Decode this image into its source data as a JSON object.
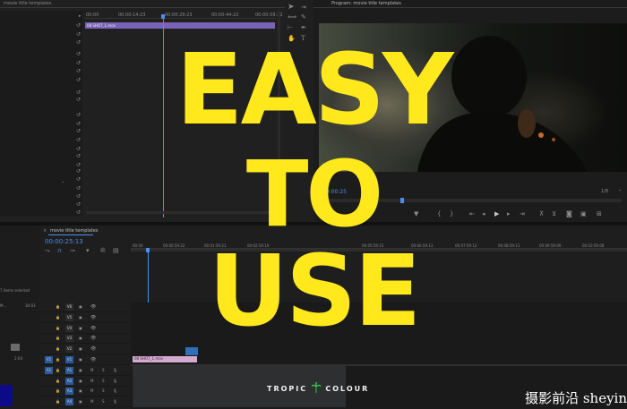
{
  "source_panel": {
    "title": "movie title templates",
    "timecodes": [
      "00:00",
      "00:00:14:23",
      "00:00:29:23",
      "00:00:44:22",
      "00:00:59:22"
    ],
    "clip_name": "08 SHOT_1.mov"
  },
  "tools_panel": {
    "tools": [
      "selection-tool",
      "track-select-tool",
      "ripple-edit-tool",
      "razor-tool",
      "slip-tool",
      "pen-tool",
      "hand-tool",
      "type-tool"
    ]
  },
  "program_monitor": {
    "title": "Program: movie title templates",
    "timecode": "00:00:25",
    "zoom": "1/8",
    "controls": [
      "marker-icon",
      "in-point-icon",
      "out-point-icon",
      "go-to-in-icon",
      "step-back-icon",
      "play-icon",
      "step-forward-icon",
      "go-to-out-icon",
      "lift-icon",
      "extract-icon",
      "export-frame-icon",
      "compare-icon",
      "multi-icon"
    ]
  },
  "timeline": {
    "title": "movie title templates",
    "timecode": "00:00:25:13",
    "ruler": [
      "00:00",
      "00:00:59:22",
      "00:01:59:21",
      "00:02:59:19",
      "00:05:59:15",
      "00:06:59:13",
      "00:07:59:12",
      "00:08:59:11",
      "00:09:59:09",
      "00:10:59:08"
    ],
    "items_selected": "7 items selected",
    "left_meta": [
      "M...",
      "30:03",
      "2:04"
    ],
    "video_tracks": [
      "V6",
      "V5",
      "V4",
      "V3",
      "V2",
      "V1"
    ],
    "audio_tracks": [
      "A1",
      "A2",
      "A3",
      "A4"
    ],
    "source_patch": [
      "V1",
      "A1"
    ],
    "clip_name": "08 SHOT_1.mov",
    "mute_label": "M",
    "solo_label": "S"
  },
  "hero": {
    "line1": "EASY",
    "line2": "TO",
    "line3": "USE"
  },
  "brand": {
    "left": "TROPIC",
    "right": "COLOUR"
  },
  "watermark": {
    "text": "摄影前沿 sheyin"
  },
  "colors": {
    "accent_yellow": "#ffe91c",
    "playhead_blue": "#4f8ee6",
    "clip_purple": "#7a62b8",
    "clip_pink": "#d4a9ce"
  }
}
